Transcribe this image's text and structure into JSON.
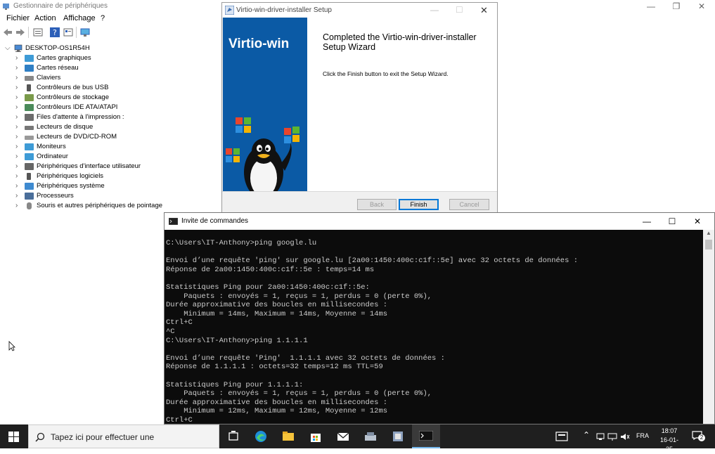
{
  "device_manager": {
    "title": "Gestionnaire de périphériques",
    "menu": [
      "Fichier",
      "Action",
      "Affichage",
      "?"
    ],
    "root": "DESKTOP-OS1R54H",
    "categories": [
      "Cartes graphiques",
      "Cartes réseau",
      "Claviers",
      "Contrôleurs de bus USB",
      "Contrôleurs de stockage",
      "Contrôleurs IDE ATA/ATAPI",
      "Files d'attente à l'impression :",
      "Lecteurs de disque",
      "Lecteurs de DVD/CD-ROM",
      "Moniteurs",
      "Ordinateur",
      "Périphériques d'interface utilisateur",
      "Périphériques logiciels",
      "Périphériques système",
      "Processeurs",
      "Souris et autres périphériques de pointage"
    ]
  },
  "installer": {
    "title": "Virtio-win-driver-installer Setup",
    "brand": "Virtio-win",
    "heading": "Completed the Virtio-win-driver-installer Setup Wizard",
    "body": "Click the Finish button to exit the Setup Wizard.",
    "buttons": {
      "back": "Back",
      "finish": "Finish",
      "cancel": "Cancel"
    }
  },
  "cmd": {
    "title": "Invite de commandes",
    "lines": [
      "C:\\Users\\IT-Anthony>ping google.lu",
      "",
      "Envoi d’une requête 'ping' sur google.lu [2a00:1450:400c:c1f::5e] avec 32 octets de données :",
      "Réponse de 2a00:1450:400c:c1f::5e : temps=14 ms",
      "",
      "Statistiques Ping pour 2a00:1450:400c:c1f::5e:",
      "    Paquets : envoyés = 1, reçus = 1, perdus = 0 (perte 0%),",
      "Durée approximative des boucles en millisecondes :",
      "    Minimum = 14ms, Maximum = 14ms, Moyenne = 14ms",
      "Ctrl+C",
      "^C",
      "C:\\Users\\IT-Anthony>ping 1.1.1.1",
      "",
      "Envoi d’une requête 'Ping'  1.1.1.1 avec 32 octets de données :",
      "Réponse de 1.1.1.1 : octets=32 temps=12 ms TTL=59",
      "",
      "Statistiques Ping pour 1.1.1.1:",
      "    Paquets : envoyés = 1, reçus = 1, perdus = 0 (perte 0%),",
      "Durée approximative des boucles en millisecondes :",
      "    Minimum = 12ms, Maximum = 12ms, Moyenne = 12ms",
      "Ctrl+C"
    ]
  },
  "taskbar": {
    "search_placeholder": "Tapez ici pour effectuer une",
    "language": "FRA",
    "time": "18:07",
    "date": "16-01-25",
    "notification_count": "2"
  },
  "colors": {
    "installer_banner": "#0b5aa5",
    "finish_border": "#0078d7",
    "console_bg": "#0c0c0c",
    "taskbar_bg": "#1f1f1f"
  }
}
